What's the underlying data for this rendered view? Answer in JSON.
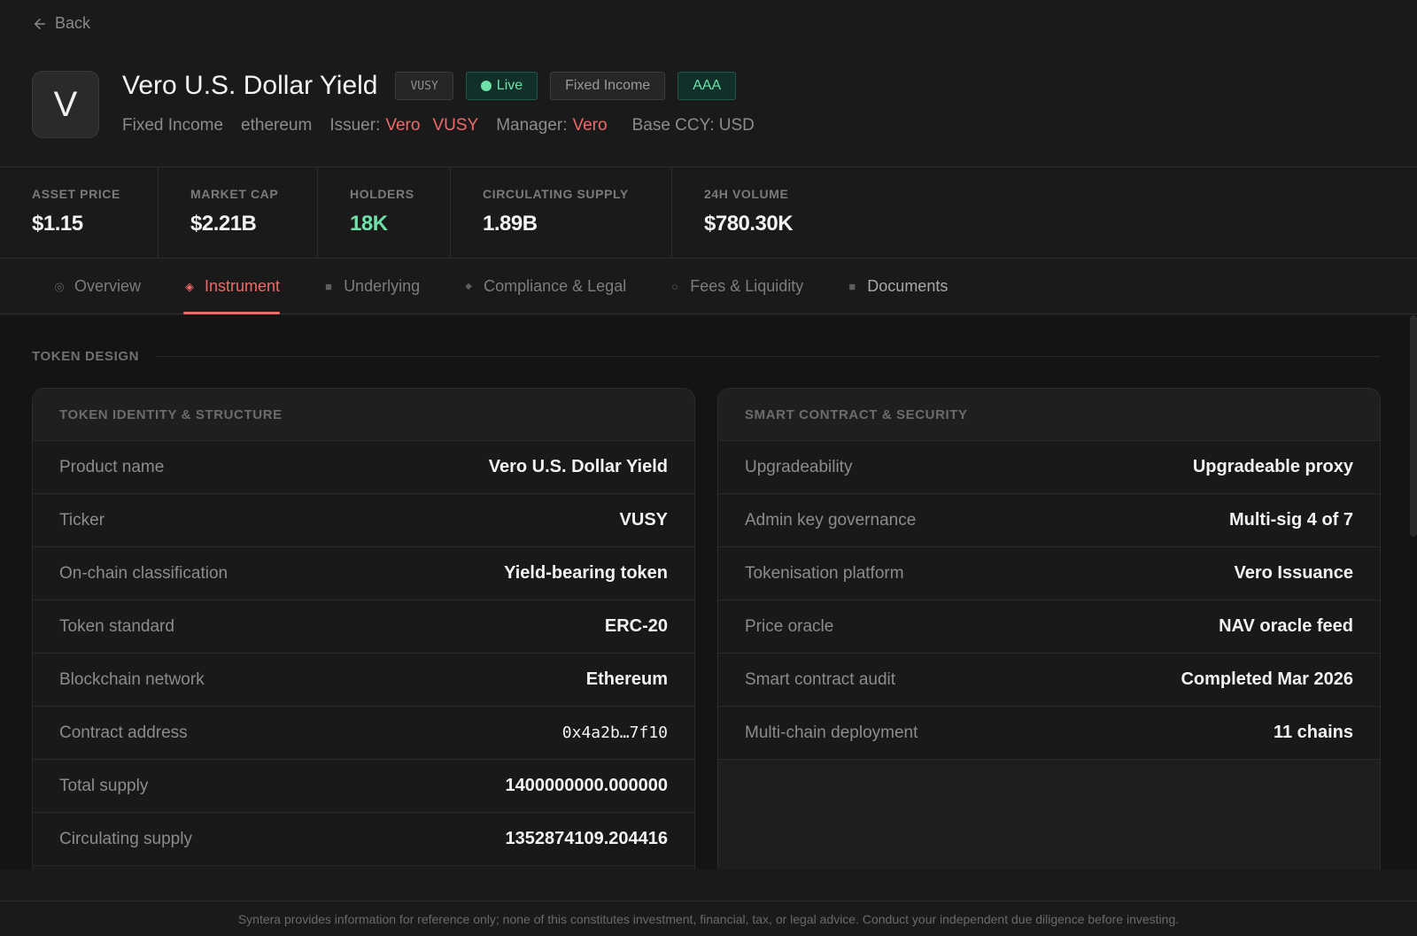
{
  "nav": {
    "back_label": "Back"
  },
  "asset": {
    "avatar_letter": "V",
    "name": "Vero U.S. Dollar Yield",
    "ticker": "VUSY",
    "status": "Live",
    "category": "Fixed Income",
    "rating": "AAA",
    "meta": {
      "category": "Fixed Income",
      "network": "ethereum",
      "issuer_label": "Issuer:",
      "issuer_name": "Vero",
      "issuer_ticker": "VUSY",
      "manager_label": "Manager:",
      "manager_name": "Vero",
      "base_ccy": "Base CCY: USD"
    }
  },
  "stats": [
    {
      "label": "ASSET PRICE",
      "value": "$1.15"
    },
    {
      "label": "MARKET CAP",
      "value": "$2.21B"
    },
    {
      "label": "HOLDERS",
      "value": "18K"
    },
    {
      "label": "CIRCULATING SUPPLY",
      "value": "1.89B"
    },
    {
      "label": "24H VOLUME",
      "value": "$780.30K"
    }
  ],
  "tabs": [
    {
      "label": "Overview",
      "icon": "circle-icon"
    },
    {
      "label": "Instrument",
      "icon": "diamond-icon"
    },
    {
      "label": "Underlying",
      "icon": "square-icon"
    },
    {
      "label": "Compliance & Legal",
      "icon": "small-diamond-icon"
    },
    {
      "label": "Fees & Liquidity",
      "icon": "ring-icon"
    },
    {
      "label": "Documents",
      "icon": "square-icon"
    }
  ],
  "section": {
    "title": "TOKEN DESIGN"
  },
  "left_panel": {
    "title": "TOKEN IDENTITY & STRUCTURE",
    "rows": [
      {
        "label": "Product name",
        "value": "Vero U.S. Dollar Yield"
      },
      {
        "label": "Ticker",
        "value": "VUSY"
      },
      {
        "label": "On-chain classification",
        "value": "Yield-bearing token"
      },
      {
        "label": "Token standard",
        "value": "ERC-20"
      },
      {
        "label": "Blockchain network",
        "value": "Ethereum"
      },
      {
        "label": "Contract address",
        "value": "0x4a2b…7f10"
      },
      {
        "label": "Total supply",
        "value": "1400000000.000000"
      },
      {
        "label": "Circulating supply",
        "value": "1352874109.204416"
      }
    ]
  },
  "right_panel": {
    "title": "SMART CONTRACT & SECURITY",
    "rows": [
      {
        "label": "Upgradeability",
        "value": "Upgradeable proxy"
      },
      {
        "label": "Admin key governance",
        "value": "Multi-sig 4 of 7"
      },
      {
        "label": "Tokenisation platform",
        "value": "Vero Issuance"
      },
      {
        "label": "Price oracle",
        "value": "NAV oracle feed"
      },
      {
        "label": "Smart contract audit",
        "value": "Completed Mar 2026"
      },
      {
        "label": "Multi-chain deployment",
        "value": "11 chains"
      }
    ]
  },
  "footer": {
    "disclaimer": "Syntera provides information for reference only; none of this constitutes investment, financial, tax, or legal advice. Conduct your independent due diligence before investing."
  },
  "colors": {
    "accent": "#f06a6a",
    "positive": "#6ee2a8",
    "background": "#1a1a1a"
  }
}
